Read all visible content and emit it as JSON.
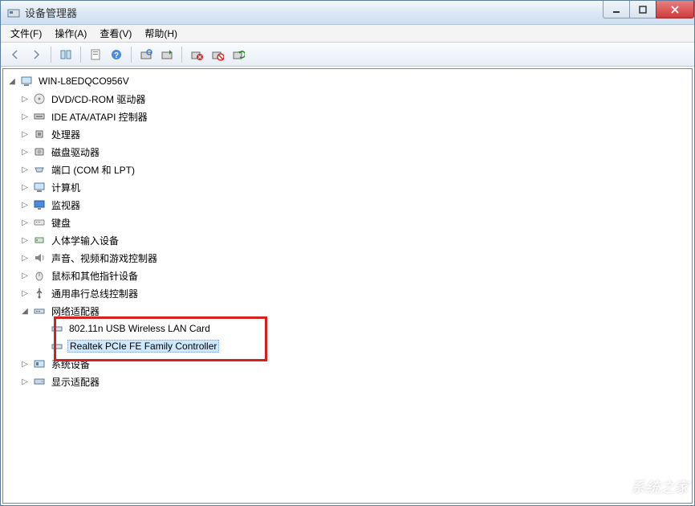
{
  "window": {
    "title": "设备管理器"
  },
  "menu": {
    "file": "文件(F)",
    "action": "操作(A)",
    "view": "查看(V)",
    "help": "帮助(H)"
  },
  "tree": {
    "root": "WIN-L8EDQCO956V",
    "nodes": {
      "dvd": "DVD/CD-ROM 驱动器",
      "ide": "IDE ATA/ATAPI 控制器",
      "cpu": "处理器",
      "disk": "磁盘驱动器",
      "ports": "端口 (COM 和 LPT)",
      "computer": "计算机",
      "monitor": "监视器",
      "keyboard": "键盘",
      "hid": "人体学输入设备",
      "sound": "声音、视频和游戏控制器",
      "mouse": "鼠标和其他指针设备",
      "usb": "通用串行总线控制器",
      "network": "网络适配器",
      "net_children": {
        "wifi": "802.11n USB Wireless LAN Card",
        "realtek": "Realtek PCIe FE Family Controller"
      },
      "system": "系统设备",
      "display": "显示适配器"
    }
  },
  "watermark": "系统之家"
}
